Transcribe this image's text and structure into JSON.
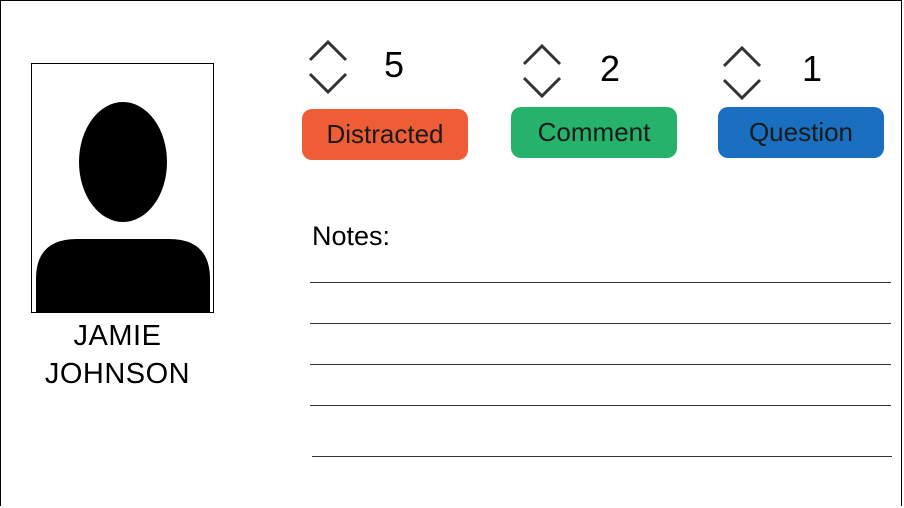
{
  "student": {
    "first_name": "JAMIE",
    "last_name": "JOHNSON"
  },
  "counters": [
    {
      "label": "Distracted",
      "count": "5",
      "color": "#ee5d36"
    },
    {
      "label": "Comment",
      "count": "2",
      "color": "#27b26c"
    },
    {
      "label": "Question",
      "count": "1",
      "color": "#1a6fc0"
    }
  ],
  "icons": {
    "increment": "chevron-up-icon",
    "decrement": "chevron-down-icon",
    "avatar": "person-silhouette-icon"
  },
  "notes": {
    "label": "Notes:",
    "line_count": 5
  }
}
